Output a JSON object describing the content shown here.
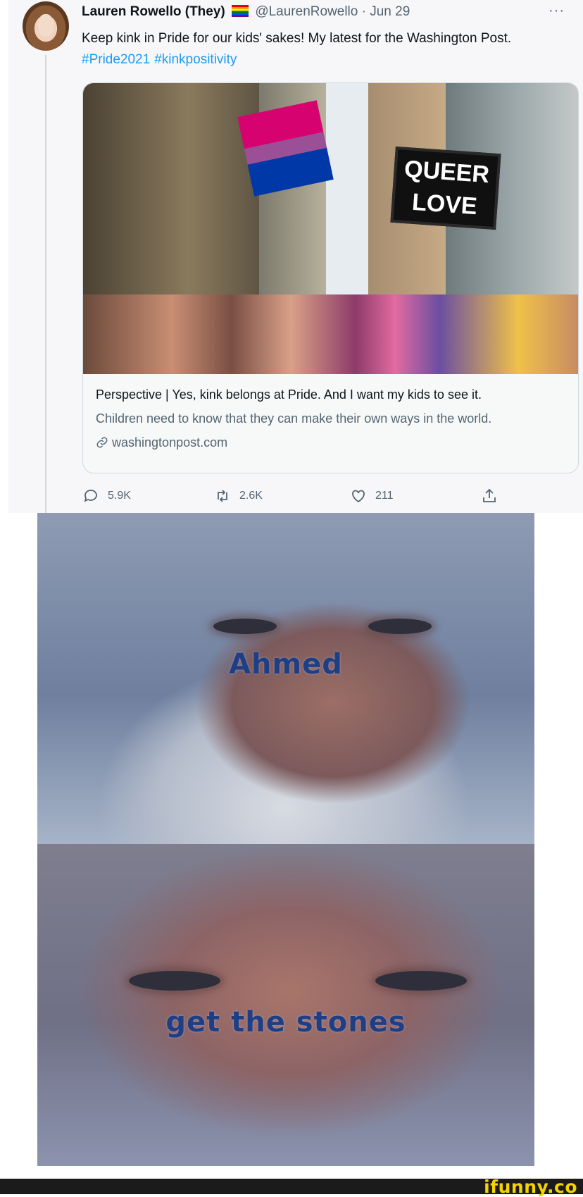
{
  "tweet": {
    "display_name": "Lauren Rowello (They)",
    "handle_date": "@LaurenRowello · Jun 29",
    "more_label": "···",
    "text": "Keep kink in Pride for our kids' sakes! My latest for the Washington Post.",
    "hashtags": [
      "#Pride2021",
      "#kinkpositivity"
    ],
    "card": {
      "sign_line1": "QUEER",
      "sign_line2": "LOVE",
      "title": "Perspective | Yes, kink belongs at Pride. And I want my kids to see it.",
      "description": "Children need to know that they can make their own ways in the world.",
      "domain": "washingtonpost.com"
    },
    "actions": {
      "replies": "5.9K",
      "retweets": "2.6K",
      "likes": "211"
    }
  },
  "meme": {
    "caption_top": "Ahmed",
    "caption_bottom": "get the stones"
  },
  "watermark": "ifunny.co",
  "colors": {
    "link": "#1d9bf0",
    "muted": "#536471",
    "caption": "#1e3f86",
    "watermark": "#f6d300"
  }
}
